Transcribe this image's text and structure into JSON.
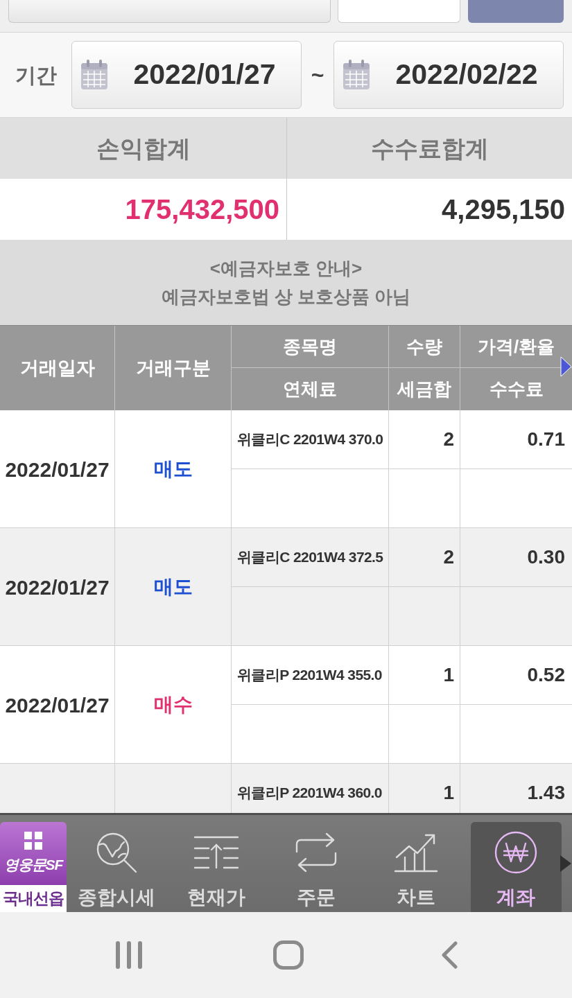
{
  "period": {
    "label": "기간",
    "from": "2022/01/27",
    "separator": "~",
    "to": "2022/02/22"
  },
  "summary": [
    {
      "label": "손익합계",
      "value": "175,432,500",
      "kind": "profit"
    },
    {
      "label": "수수료합계",
      "value": "4,295,150",
      "kind": "plain"
    }
  ],
  "notice": {
    "title": "<예금자보호 안내>",
    "text": "예금자보호법 상 보호상품 아님"
  },
  "table": {
    "columns": [
      {
        "labels": [
          "거래일자"
        ]
      },
      {
        "labels": [
          "거래구분"
        ]
      },
      {
        "labels": [
          "종목명",
          "연체료"
        ]
      },
      {
        "labels": [
          "수량",
          "세금합"
        ]
      },
      {
        "labels": [
          "가격/환율",
          "수수료"
        ]
      }
    ],
    "rows": [
      {
        "date": "2022/01/27",
        "kind": "sell",
        "type": "매도",
        "name": "위클리C 2201W4 370.0",
        "quantity": "2",
        "price": "0.71"
      },
      {
        "date": "2022/01/27",
        "kind": "sell",
        "type": "매도",
        "name": "위클리C 2201W4 372.5",
        "quantity": "2",
        "price": "0.30"
      },
      {
        "date": "2022/01/27",
        "kind": "buy",
        "type": "매수",
        "name": "위클리P 2201W4 355.0",
        "quantity": "1",
        "price": "0.52"
      },
      {
        "name": "위클리P 2201W4 360.0",
        "quantity": "1",
        "price": "1.43"
      }
    ]
  },
  "bottom_nav": {
    "logo": {
      "name": "영웅문SF",
      "market": "국내선옵"
    },
    "items": [
      {
        "label": "종합시세",
        "selected": false
      },
      {
        "label": "현재가",
        "selected": false
      },
      {
        "label": "주문",
        "selected": false
      },
      {
        "label": "차트",
        "selected": false
      },
      {
        "label": "계좌",
        "selected": true
      }
    ]
  }
}
